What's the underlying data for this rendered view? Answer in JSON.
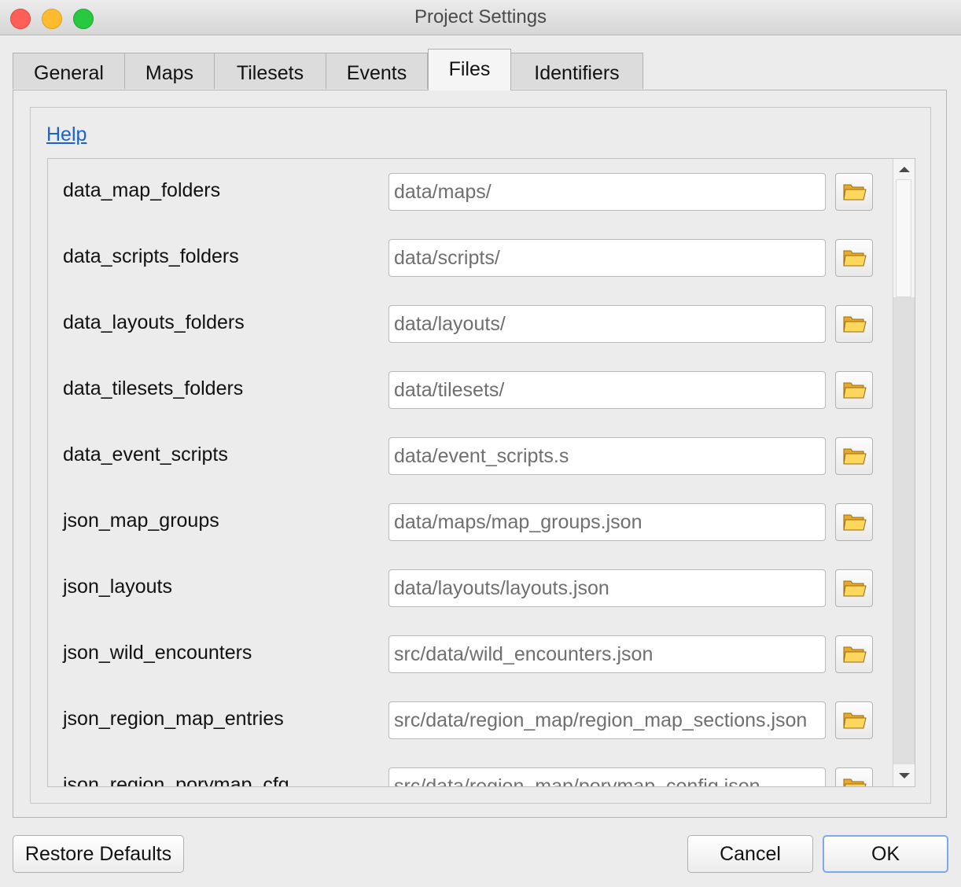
{
  "window": {
    "title": "Project Settings"
  },
  "tabs": [
    {
      "label": "General",
      "active": false
    },
    {
      "label": "Maps",
      "active": false
    },
    {
      "label": "Tilesets",
      "active": false
    },
    {
      "label": "Events",
      "active": false
    },
    {
      "label": "Files",
      "active": true
    },
    {
      "label": "Identifiers",
      "active": false
    }
  ],
  "files_tab": {
    "help_link": "Help",
    "rows": [
      {
        "label": "data_map_folders",
        "value": "data/maps/"
      },
      {
        "label": "data_scripts_folders",
        "value": "data/scripts/"
      },
      {
        "label": "data_layouts_folders",
        "value": "data/layouts/"
      },
      {
        "label": "data_tilesets_folders",
        "value": "data/tilesets/"
      },
      {
        "label": "data_event_scripts",
        "value": "data/event_scripts.s"
      },
      {
        "label": "json_map_groups",
        "value": "data/maps/map_groups.json"
      },
      {
        "label": "json_layouts",
        "value": "data/layouts/layouts.json"
      },
      {
        "label": "json_wild_encounters",
        "value": "src/data/wild_encounters.json"
      },
      {
        "label": "json_region_map_entries",
        "value": "src/data/region_map/region_map_sections.json"
      },
      {
        "label": "json_region_porymap_cfg",
        "value": "src/data/region_map/porymap_config.json"
      }
    ],
    "browse_icon": "folder-open-icon"
  },
  "buttons": {
    "restore_defaults": "Restore Defaults",
    "cancel": "Cancel",
    "ok": "OK"
  },
  "colors": {
    "link": "#1a62d2",
    "close": "#fc5f57",
    "minimize": "#fdbc2e",
    "maximize": "#28c840",
    "default_button_border": "#7aa9f0"
  }
}
